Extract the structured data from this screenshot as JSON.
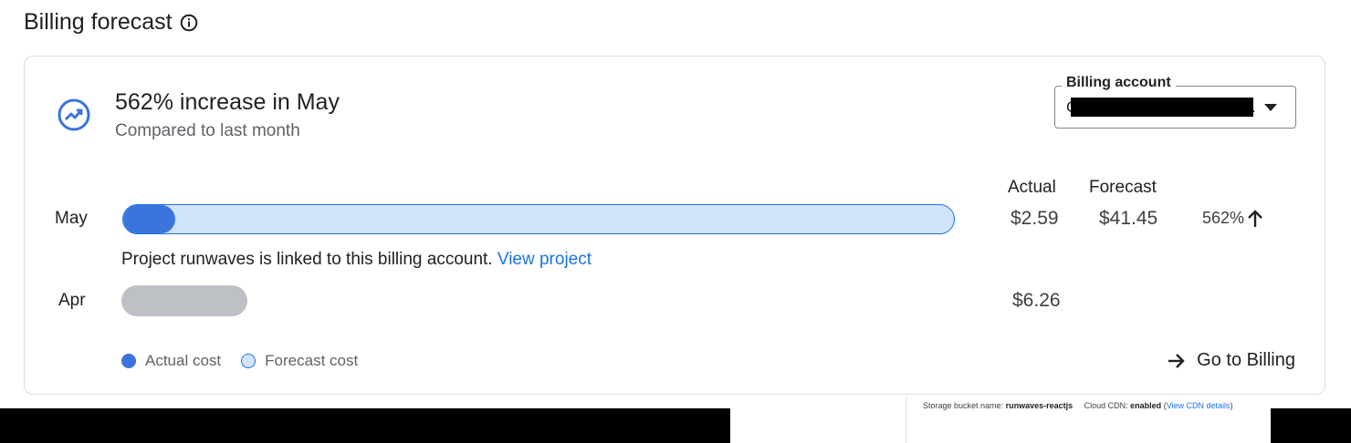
{
  "header": {
    "title": "Billing forecast",
    "info_icon": "info-icon"
  },
  "summary": {
    "headline": "562% increase in May",
    "subtitle": "Compared to last month",
    "icon": "trending-up-icon"
  },
  "billing_account": {
    "label": "Billing account",
    "value_prefix": "C",
    "value_suffix": "."
  },
  "columns": {
    "actual": "Actual",
    "forecast": "Forecast"
  },
  "rows": [
    {
      "label": "May",
      "actual": "$2.59",
      "forecast": "$41.45",
      "change": "562%",
      "actual_fraction": 0.0625
    },
    {
      "label": "Apr",
      "actual": "$6.26"
    }
  ],
  "project_note": {
    "text": "Project runwaves is linked to this billing account.",
    "link": "View project"
  },
  "legend": {
    "actual": "Actual cost",
    "forecast": "Forecast cost"
  },
  "go_to_billing": "Go to Billing",
  "bottom_strip": {
    "bucket_label": "Storage bucket name:",
    "bucket_value": "runwaves-reactjs",
    "cdn_label": "Cloud CDN:",
    "cdn_value": "enabled",
    "cdn_link": "View CDN details"
  },
  "colors": {
    "accent": "#1a73e8",
    "actual": "#3a74dc",
    "forecast": "#d2e3fc",
    "previous": "#bdc1c6"
  }
}
